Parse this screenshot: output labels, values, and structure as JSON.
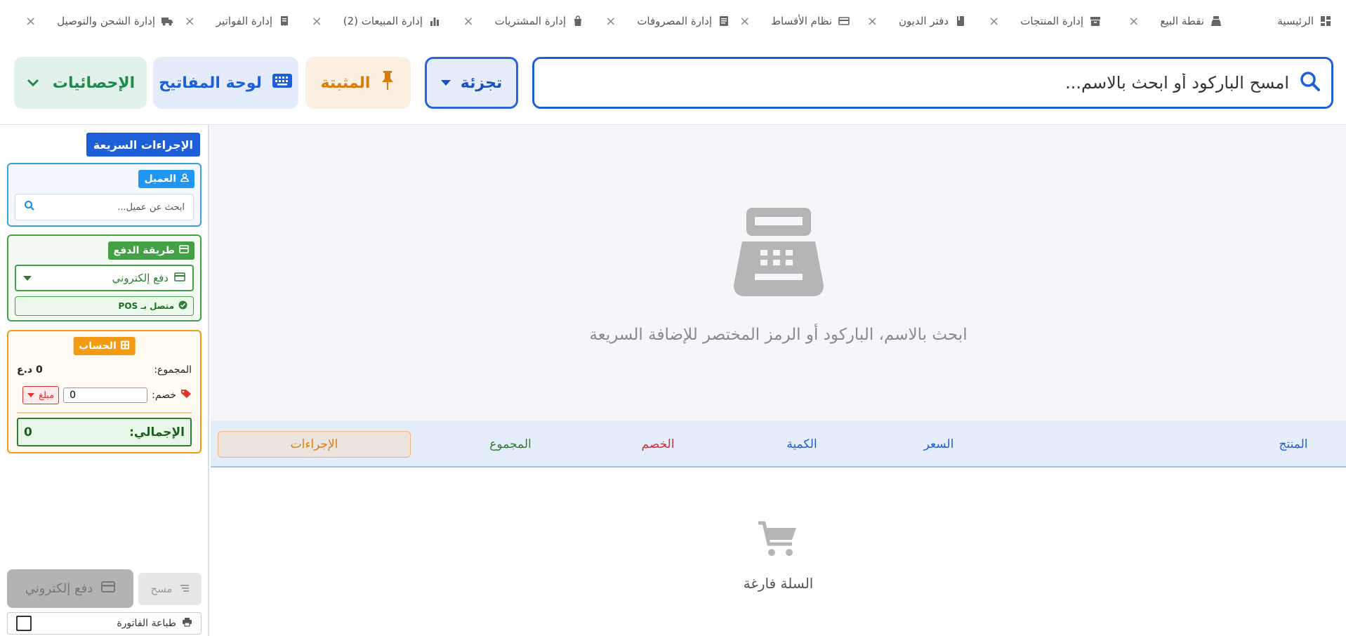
{
  "tabs": [
    {
      "label": "الرئيسية",
      "icon": "dashboard-icon",
      "closable": false
    },
    {
      "label": "نقطة البيع",
      "icon": "cash-register-icon",
      "closable": true
    },
    {
      "label": "إدارة المنتجات",
      "icon": "archive-icon",
      "closable": true
    },
    {
      "label": "دفتر الديون",
      "icon": "book-icon",
      "closable": true
    },
    {
      "label": "نظام الأقساط",
      "icon": "credit-card-icon",
      "closable": true
    },
    {
      "label": "إدارة المصروفات",
      "icon": "document-icon",
      "closable": true
    },
    {
      "label": "إدارة المشتريات",
      "icon": "shopping-bag-icon",
      "closable": true
    },
    {
      "label": "إدارة المبيعات (2)",
      "icon": "bar-chart-icon",
      "closable": true
    },
    {
      "label": "إدارة الفواتير",
      "icon": "receipt-icon",
      "closable": true
    },
    {
      "label": "إدارة الشحن والتوصيل",
      "icon": "truck-icon",
      "closable": true
    }
  ],
  "toolbar": {
    "search_placeholder": "امسح الباركود أو ابحث بالاسم...",
    "split_label": "تجزئة",
    "pinned_label": "المثبتة",
    "keyboard_label": "لوحة المفاتيح",
    "stats_label": "الإحصائيات"
  },
  "sidebar": {
    "quick_actions_title": "الإجراءات السريعة",
    "client": {
      "tag": "العميل",
      "search_placeholder": "ابحث عن عميل..."
    },
    "payment": {
      "tag": "طريقة الدفع",
      "selected": "دفع إلكتروني",
      "pos_status": "متصل بـ POS"
    },
    "account": {
      "tag": "الحساب",
      "subtotal_label": "المجموع:",
      "subtotal_value": "0 د.ع",
      "discount_label": "خصم:",
      "discount_value": "0",
      "discount_type": "مبلغ",
      "grand_total_label": "الإجمالي:",
      "grand_total_value": "0"
    },
    "clear_label": "مسح",
    "pay_label": "دفع إلكتروني",
    "print_label": "طباعة الفاتورة"
  },
  "main": {
    "empty_search_text": "ابحث بالاسم، الباركود أو الرمز المختصر للإضافة السريعة",
    "columns": {
      "product": "المنتج",
      "price": "السعر",
      "quantity": "الكمية",
      "discount": "الخصم",
      "total": "المجموع",
      "actions": "الإجراءات"
    },
    "empty_cart_text": "السلة فارغة"
  },
  "colors": {
    "primary": "#1e5fd8",
    "accent_orange": "#f29a11",
    "success": "#2e7d32",
    "danger": "#d32f2f"
  }
}
